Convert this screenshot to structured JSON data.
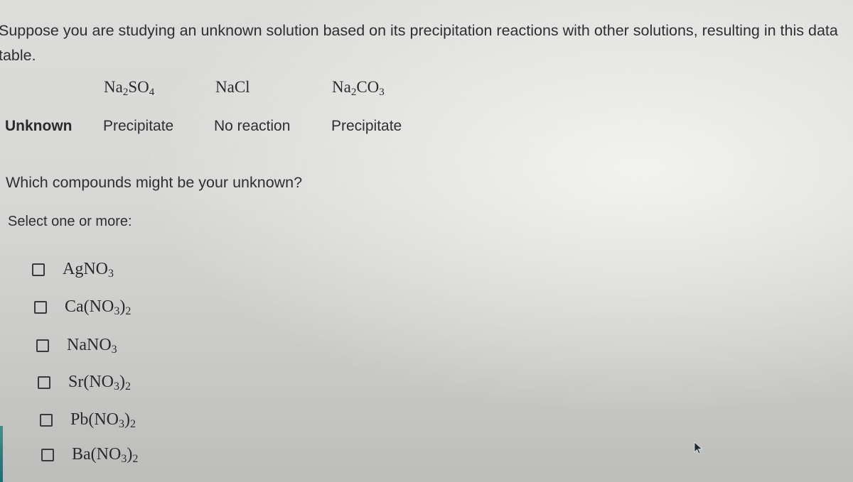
{
  "intro": {
    "text": "Suppose you are studying an unknown solution based on its precipitation reactions with other solutions, resulting in this data table."
  },
  "table": {
    "columns": [
      {
        "base": "Na",
        "sub1": "2",
        "mid": "SO",
        "sub2": "4"
      },
      {
        "base": "NaCl",
        "sub1": "",
        "mid": "",
        "sub2": ""
      },
      {
        "base": "Na",
        "sub1": "2",
        "mid": "CO",
        "sub2": "3"
      }
    ],
    "row_label": "Unknown",
    "cells": [
      "Precipitate",
      "No reaction",
      "Precipitate"
    ]
  },
  "question": {
    "text": "Which compounds might be your unknown?",
    "instruction": "Select one or more:"
  },
  "options": [
    {
      "id": "agno3",
      "pre": "AgNO",
      "sub1": "3",
      "post": "",
      "sub2": "",
      "checked": false
    },
    {
      "id": "cano32",
      "pre": "Ca(NO",
      "sub1": "3",
      "post": ")",
      "sub2": "2",
      "checked": false
    },
    {
      "id": "nano3",
      "pre": "NaNO",
      "sub1": "3",
      "post": "",
      "sub2": "",
      "checked": false
    },
    {
      "id": "srno32",
      "pre": "Sr(NO",
      "sub1": "3",
      "post": ")",
      "sub2": "2",
      "checked": false
    },
    {
      "id": "pbno32",
      "pre": "Pb(NO",
      "sub1": "3",
      "post": ")",
      "sub2": "2",
      "checked": false
    },
    {
      "id": "bano32",
      "pre": "Ba(NO",
      "sub1": "3",
      "post": ")",
      "sub2": "2",
      "checked": false
    }
  ],
  "icons": {
    "cursor": "mouse-pointer-icon",
    "checkbox": "checkbox-empty-icon"
  }
}
